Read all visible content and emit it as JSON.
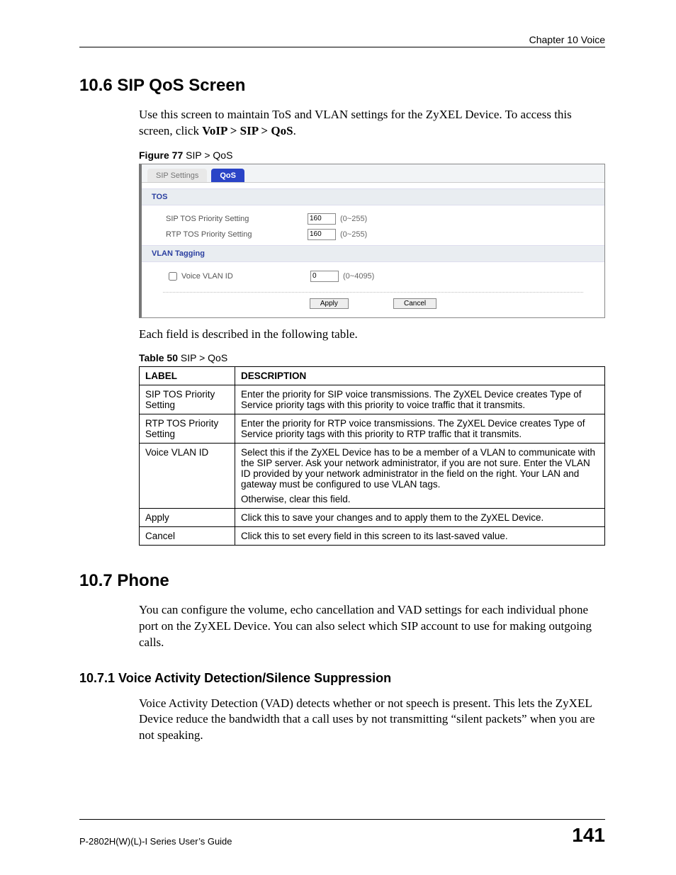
{
  "header": {
    "chapter": "Chapter 10 Voice"
  },
  "sec106": {
    "title": "10.6  SIP QoS Screen",
    "p1a": "Use this screen to maintain ToS and VLAN settings for the ZyXEL Device. To access this screen, click ",
    "p1b": "VoIP > SIP > QoS",
    "p1c": ".",
    "figcap_b": "Figure 77",
    "figcap_rest": "   SIP > QoS",
    "tabs": {
      "sip": "SIP Settings",
      "qos": "QoS"
    },
    "group_tos": "TOS",
    "sip_tos_label": "SIP TOS Priority Setting",
    "rtp_tos_label": "RTP TOS Priority Setting",
    "sip_tos_val": "160",
    "rtp_tos_val": "160",
    "tos_range": "(0~255)",
    "group_vlan": "VLAN Tagging",
    "voice_vlan_label": "Voice VLAN ID",
    "voice_vlan_val": "0",
    "vlan_range": "(0~4095)",
    "apply": "Apply",
    "cancel": "Cancel",
    "after_fig": "Each field is described in the following table.",
    "tblcap_b": "Table 50",
    "tblcap_rest": "   SIP > QoS",
    "th_label": "LABEL",
    "th_desc": "DESCRIPTION",
    "rows": [
      {
        "label": "SIP TOS Priority Setting",
        "desc": "Enter the priority for SIP voice transmissions. The ZyXEL Device creates Type of Service priority tags with this priority to voice traffic that it transmits."
      },
      {
        "label": "RTP TOS Priority Setting",
        "desc": "Enter the priority for RTP voice transmissions. The ZyXEL Device creates Type of Service priority tags with this priority to RTP traffic that it transmits."
      },
      {
        "label": "Voice VLAN ID",
        "desc": "Select this if the ZyXEL Device has to be a member of a VLAN to communicate with the SIP server. Ask your network administrator, if you are not sure. Enter the VLAN ID provided by your network administrator in the field on the right. Your LAN and gateway must be configured to use VLAN tags.",
        "desc2": "Otherwise, clear this field."
      },
      {
        "label": "Apply",
        "desc": "Click this to save your changes and to apply them to the ZyXEL Device."
      },
      {
        "label": "Cancel",
        "desc": "Click this to set every field in this screen to its last-saved value."
      }
    ]
  },
  "sec107": {
    "title": "10.7  Phone",
    "p": "You can configure the volume, echo cancellation and VAD settings for each individual phone port on the ZyXEL Device. You can also select which SIP account to use for making outgoing calls."
  },
  "sec1071": {
    "title": "10.7.1  Voice Activity Detection/Silence Suppression",
    "p": "Voice Activity Detection (VAD) detects whether or not speech is present. This lets the ZyXEL Device reduce the bandwidth that a call uses by not transmitting “silent packets” when you are not speaking."
  },
  "footer": {
    "guide": "P-2802H(W)(L)-I Series User’s Guide",
    "page": "141"
  }
}
